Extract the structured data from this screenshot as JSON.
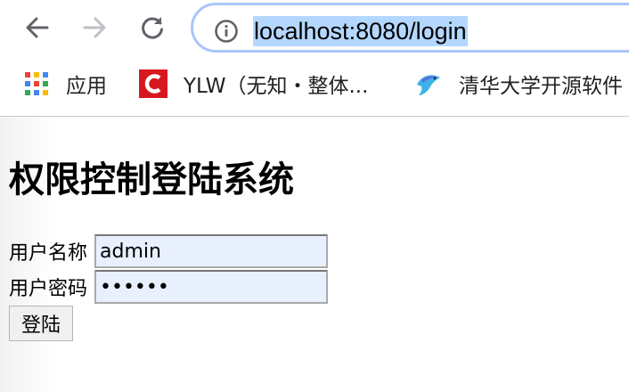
{
  "browser": {
    "url": "localhost:8080/login",
    "bookmarks": [
      {
        "label": "应用",
        "icon": "apps-grid-icon"
      },
      {
        "label": "YLW（无知・整体...",
        "icon": "ylw-logo-icon"
      },
      {
        "label": "清华大学开源软件",
        "icon": "tuna-logo-icon"
      }
    ],
    "colors": {
      "omnibox_border": "#a8c7fa",
      "url_highlight": "#b4d7ff"
    }
  },
  "page": {
    "title": "权限控制登陆系统",
    "form": {
      "username_label": "用户名称",
      "username_value": "admin",
      "password_label": "用户密码",
      "password_value": "••••••",
      "submit_label": "登陆"
    },
    "colors": {
      "autofill_bg": "#e8f0fe"
    }
  }
}
